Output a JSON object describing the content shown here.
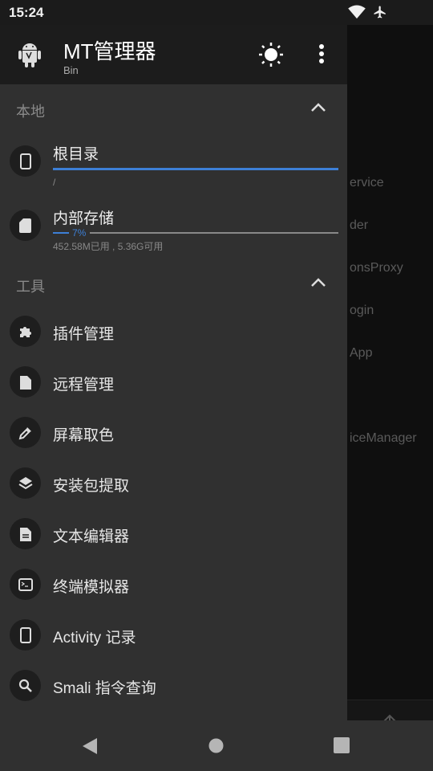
{
  "status": {
    "time": "15:24",
    "icons": [
      "wifi-icon",
      "airplane-icon"
    ]
  },
  "header": {
    "title": "MT管理器",
    "subtitle": "Bin",
    "icons": [
      "android-icon",
      "brightness-icon",
      "more-icon"
    ]
  },
  "local": {
    "title": "本地",
    "root": {
      "name": "根目录",
      "path": "/"
    },
    "storage": {
      "name": "内部存储",
      "percent": "7%",
      "usage": "452.58M已用 , 5.36G可用",
      "used_fraction": 0.07
    }
  },
  "tools": {
    "title": "工具",
    "items": [
      {
        "label": "插件管理",
        "icon": "puzzle-icon"
      },
      {
        "label": "远程管理",
        "icon": "file-icon"
      },
      {
        "label": "屏幕取色",
        "icon": "eyedropper-icon"
      },
      {
        "label": "安装包提取",
        "icon": "layers-icon"
      },
      {
        "label": "文本编辑器",
        "icon": "document-icon"
      },
      {
        "label": "终端模拟器",
        "icon": "terminal-icon"
      },
      {
        "label": "Activity 记录",
        "icon": "phone-icon"
      },
      {
        "label": "Smali 指令查询",
        "icon": "search-icon"
      }
    ]
  },
  "background": {
    "items": [
      "ervice",
      "der",
      "onsProxy",
      "ogin",
      "App",
      "iceManager"
    ]
  },
  "colors": {
    "accent": "#3d7fd6",
    "drawer": "#303030",
    "header": "#1c1c1c"
  }
}
